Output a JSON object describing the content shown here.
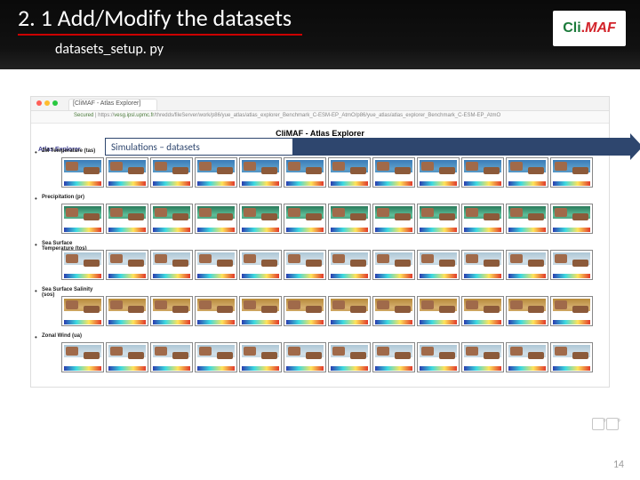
{
  "header": {
    "title": "2. 1 Add/Modify the datasets",
    "subtitle": "datasets_setup. py"
  },
  "logo": {
    "c": "C",
    "li": "li",
    "dot": ".",
    "maf": "MAF"
  },
  "browser": {
    "tab_label": "[CliMAF - Atlas Explorer]",
    "url_secure": "Secured",
    "url_host": "vesg.ipsl.upmc.fr",
    "url_path": "/thredds/fileServer/work/p86/yue_atlas/atlas_explorer_Benchmark_C-ESM-EP_AtmO/p86/yue_atlas/atlas_explorer_Benchmark_C-ESM-EP_AtmO",
    "page_title": "CliMAF - Atlas Explorer",
    "side_label": "Atlas Explorer"
  },
  "callout": {
    "label": "Simulations – datasets"
  },
  "rows": [
    {
      "label": "2M Temperature (tas)",
      "kind": "warm"
    },
    {
      "label": "Precipitation (pr)",
      "kind": "green"
    },
    {
      "label": "Sea Surface Temperature (tos)",
      "kind": "pale"
    },
    {
      "label": "Sea Surface Salinity (sos)",
      "kind": "salty"
    },
    {
      "label": "Zonal Wind (ua)",
      "kind": "pale"
    }
  ],
  "page_number": "14"
}
